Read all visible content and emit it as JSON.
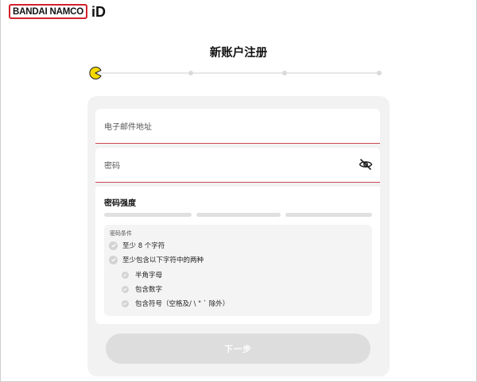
{
  "header": {
    "brand": "BANDAI NAMCO",
    "brand_id": "iD"
  },
  "page": {
    "title": "新账户注册"
  },
  "progress": {
    "current_step": 1,
    "total_steps": 4
  },
  "form": {
    "email": {
      "label": "电子邮件地址",
      "value": ""
    },
    "password": {
      "label": "密码",
      "value": "",
      "toggle_icon": "eye-slash-icon"
    }
  },
  "strength": {
    "title": "密码强度",
    "level": 0,
    "conditions_title": "密码条件",
    "conditions": [
      {
        "text": "至少 8 个字符",
        "met": false
      },
      {
        "text": "至少包含以下字符中的两种",
        "met": false,
        "sub": [
          {
            "text": "半角字母",
            "met": false
          },
          {
            "text": "包含数字",
            "met": false
          },
          {
            "text": "包含符号（空格及/ \\ \" ` 除外）",
            "met": false
          }
        ]
      }
    ]
  },
  "actions": {
    "next_label": "下一步"
  },
  "colors": {
    "brand_red": "#d2222d",
    "underline": "#c9474e",
    "pacman": "#f5d800",
    "disabled": "#dddddd"
  }
}
